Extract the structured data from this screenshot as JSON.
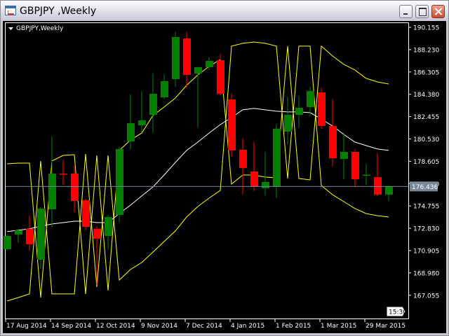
{
  "window": {
    "title": "GBPJPY ,Weekly",
    "icon": "chart-window-icon"
  },
  "chart_label": "GBPJPY,Weekly",
  "colors": {
    "background": "#000000",
    "bull": "#008000",
    "bear": "#ff0000",
    "bands": "#ffff00",
    "middle": "#ffffff",
    "price_line": "#778899",
    "foreground": "#ffffff"
  },
  "time_label": "15:30",
  "chart_data": {
    "type": "candlestick",
    "symbol": "GBPJPY",
    "timeframe": "Weekly",
    "ylim": [
      166.2,
      190.6
    ],
    "price_ticks": [
      "190.155",
      "188.230",
      "186.305",
      "184.380",
      "182.455",
      "180.530",
      "178.605",
      "176.680",
      "174.755",
      "172.830",
      "170.905",
      "168.980",
      "167.055"
    ],
    "date_ticks": [
      "17 Aug 2014",
      "14 Sep 2014",
      "12 Oct 2014",
      "9 Nov 2014",
      "7 Dec 2014",
      "4 Jan 2015",
      "1 Feb 2015",
      "1 Mar 2015",
      "29 Mar 2015"
    ],
    "current_price": "176.436",
    "candles": [
      [
        171.03,
        172.3,
        170.9,
        172.17
      ],
      [
        172.29,
        172.78,
        171.57,
        172.66
      ],
      [
        172.78,
        173.92,
        170.91,
        171.45
      ],
      [
        170.12,
        174.65,
        169.34,
        174.53
      ],
      [
        174.47,
        180.74,
        172.9,
        177.54
      ],
      [
        177.54,
        178.75,
        176.58,
        177.5
      ],
      [
        177.54,
        178.21,
        174.22,
        175.19
      ],
      [
        175.25,
        175.37,
        172.66,
        172.96
      ],
      [
        172.78,
        173.02,
        167.95,
        171.93
      ],
      [
        172.17,
        173.98,
        170.97,
        173.8
      ],
      [
        173.98,
        179.84,
        173.32,
        179.66
      ],
      [
        180.32,
        184.36,
        179.6,
        181.89
      ],
      [
        181.71,
        184.66,
        181.1,
        182.13
      ],
      [
        182.61,
        186.17,
        181.04,
        184.42
      ],
      [
        184.12,
        186.11,
        184.0,
        185.51
      ],
      [
        185.69,
        189.73,
        185.03,
        189.31
      ],
      [
        189.19,
        189.73,
        184.91,
        186.05
      ],
      [
        186.17,
        186.72,
        181.49,
        186.72
      ],
      [
        186.72,
        187.56,
        186.47,
        187.26
      ],
      [
        187.32,
        187.86,
        184.3,
        184.42
      ],
      [
        183.94,
        184.42,
        178.99,
        179.54
      ],
      [
        179.6,
        180.56,
        175.73,
        178.03
      ],
      [
        177.73,
        180.26,
        176.04,
        176.4
      ],
      [
        176.28,
        179.41,
        175.67,
        176.82
      ],
      [
        176.4,
        181.83,
        175.43,
        181.41
      ],
      [
        181.16,
        184.18,
        180.08,
        182.61
      ],
      [
        182.61,
        184.24,
        181.47,
        183.22
      ],
      [
        183.28,
        185.03,
        182.55,
        184.66
      ],
      [
        184.54,
        184.97,
        181.41,
        181.65
      ],
      [
        181.65,
        183.94,
        178.15,
        178.87
      ],
      [
        178.81,
        181.04,
        177.06,
        179.41
      ],
      [
        179.41,
        179.66,
        176.4,
        177.06
      ],
      [
        177.42,
        178.39,
        176.58,
        177.45
      ],
      [
        177.24,
        179.29,
        175.61,
        175.73
      ],
      [
        175.73,
        176.52,
        175.19,
        176.436
      ]
    ],
    "middle_line": [
      172.54,
      172.66,
      172.78,
      173.02,
      173.2,
      173.32,
      173.44,
      173.44,
      173.32,
      173.32,
      174.1,
      174.83,
      175.61,
      176.4,
      177.42,
      178.51,
      179.54,
      180.26,
      181.04,
      181.77,
      182.37,
      183.04,
      183.16,
      183.04,
      182.92,
      182.86,
      182.86,
      182.8,
      182.25,
      181.65,
      180.92,
      180.26,
      179.96,
      179.66,
      179.54
    ],
    "band_a": [
      178.39,
      178.45,
      178.45,
      166.86,
      178.63,
      179.11,
      179.17,
      167.17,
      179.11,
      167.47,
      179.54,
      180.44,
      181.04,
      182.55,
      183.28,
      184.06,
      185.15,
      186.05,
      186.78,
      187.38,
      176.64,
      177.42,
      177.42,
      177.24,
      177.18,
      188.53,
      177.12,
      177.0,
      188.53,
      187.68,
      186.96,
      186.47,
      185.75,
      185.45,
      185.27
    ],
    "band_b": [
      166.56,
      166.86,
      167.17,
      178.63,
      167.17,
      167.17,
      167.17,
      179.23,
      167.77,
      179.11,
      168.37,
      169.28,
      169.88,
      170.78,
      171.69,
      172.6,
      173.8,
      174.71,
      175.43,
      176.09,
      188.53,
      188.77,
      188.89,
      188.77,
      188.53,
      177.12,
      188.53,
      188.53,
      176.52,
      175.73,
      175.13,
      174.53,
      174.1,
      173.92,
      173.8
    ]
  }
}
